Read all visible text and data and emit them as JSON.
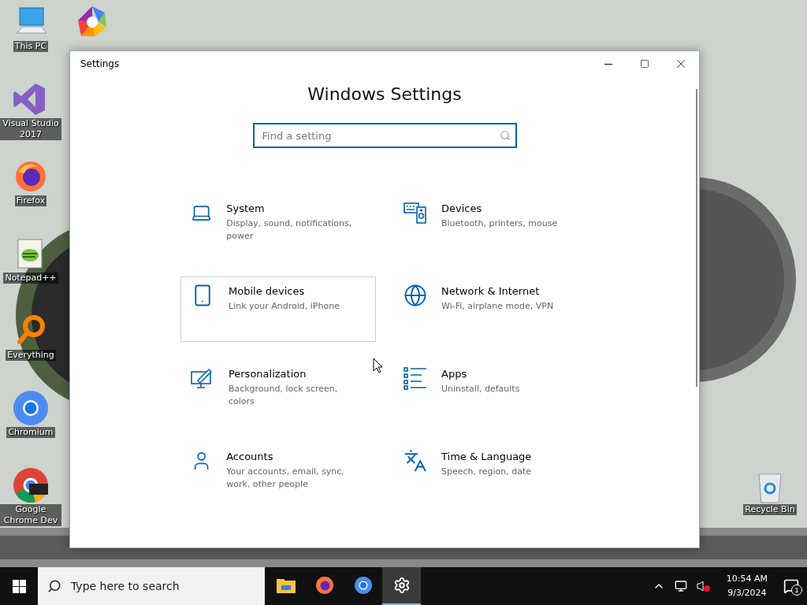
{
  "desktop_icons": [
    {
      "kind": "pc",
      "label": "This PC"
    },
    {
      "kind": "vs",
      "label": "Visual Studio 2017"
    },
    {
      "kind": "firefox",
      "label": "Firefox"
    },
    {
      "kind": "notepad",
      "label": "Notepad++"
    },
    {
      "kind": "everything",
      "label": "Everything"
    },
    {
      "kind": "chromium",
      "label": "Chromium"
    },
    {
      "kind": "chromedev",
      "label": "Google Chrome Dev"
    },
    {
      "kind": "pinwheel"
    }
  ],
  "recycle_bin": {
    "label": "Recycle Bin"
  },
  "window": {
    "title": "Settings",
    "heading": "Windows Settings",
    "search": {
      "placeholder": "Find a setting"
    },
    "categories": [
      {
        "kind": "laptop",
        "title": "System",
        "subtitle": "Display, sound, notifications, power",
        "hovered": false
      },
      {
        "kind": "devices",
        "title": "Devices",
        "subtitle": "Bluetooth, printers, mouse",
        "hovered": false
      },
      {
        "kind": "phone",
        "title": "Mobile devices",
        "subtitle": "Link your Android, iPhone",
        "hovered": true
      },
      {
        "kind": "globe",
        "title": "Network & Internet",
        "subtitle": "Wi-Fi, airplane mode, VPN",
        "hovered": false
      },
      {
        "kind": "brush",
        "title": "Personalization",
        "subtitle": "Background, lock screen, colors",
        "hovered": false
      },
      {
        "kind": "apps",
        "title": "Apps",
        "subtitle": "Uninstall, defaults",
        "hovered": false
      },
      {
        "kind": "user",
        "title": "Accounts",
        "subtitle": "Your accounts, email, sync, work, other people",
        "hovered": false
      },
      {
        "kind": "language",
        "title": "Time & Language",
        "subtitle": "Speech, region, date",
        "hovered": false
      }
    ]
  },
  "taskbar": {
    "search": {
      "placeholder": "Type here to search"
    },
    "apps": [
      {
        "kind": "folder",
        "selected": false
      },
      {
        "kind": "firefox",
        "selected": false
      },
      {
        "kind": "chromium",
        "selected": false
      },
      {
        "kind": "gear",
        "selected": true
      }
    ],
    "clock": {
      "time": "10:54 AM",
      "date": "9/3/2024"
    },
    "notification_count": "1"
  }
}
